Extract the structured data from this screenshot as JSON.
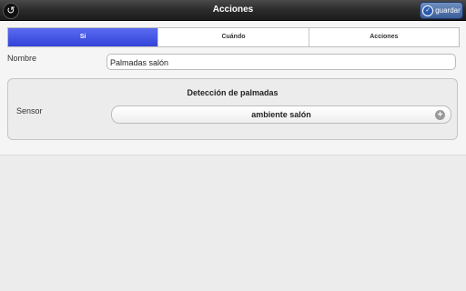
{
  "header": {
    "title": "Acciones",
    "back_icon": "back-arrow-icon",
    "save_label": "guardar",
    "save_icon": "checkmark-icon"
  },
  "tabs": [
    {
      "label": "Si",
      "active": true
    },
    {
      "label": "Cuándo",
      "active": false
    },
    {
      "label": "Acciones",
      "active": false
    }
  ],
  "form": {
    "nombre_label": "Nombre",
    "nombre_value": "Palmadas salón"
  },
  "detection": {
    "title": "Detección de palmadas",
    "sensor_label": "Sensor",
    "sensor_value": "ambiente salón",
    "add_icon": "plus-circle-icon"
  },
  "colors": {
    "active_tab": "#3f51e6",
    "header_bg": "#2b2b2b",
    "save_button": "#4a6fad"
  }
}
